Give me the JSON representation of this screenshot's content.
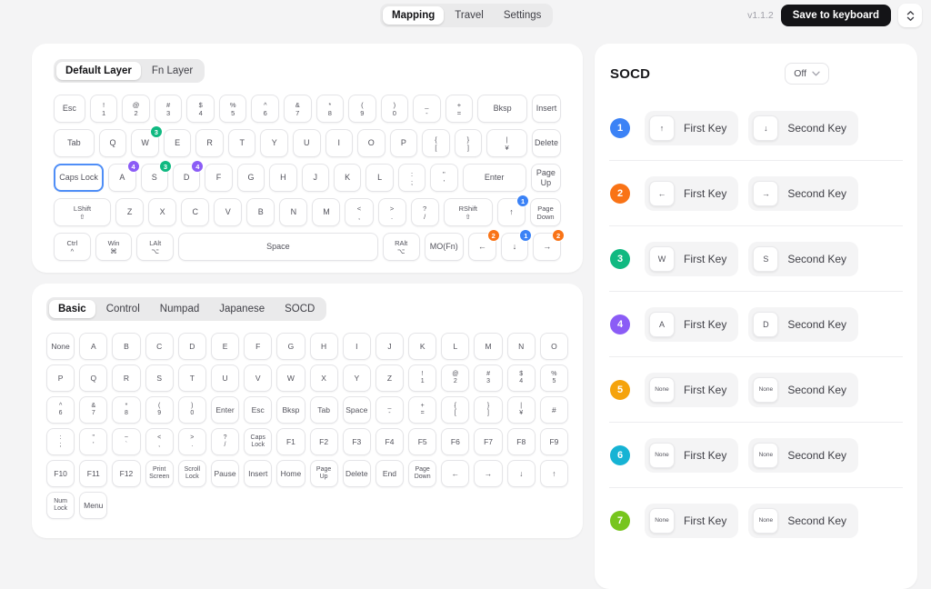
{
  "app": {
    "tabs": [
      "Mapping",
      "Travel",
      "Settings"
    ],
    "active_tab": "Mapping",
    "version": "v1.1.2",
    "save_label": "Save to keyboard",
    "updown_icon": "chevrons-up-down"
  },
  "layers": {
    "tabs": [
      "Default Layer",
      "Fn Layer"
    ],
    "active": "Default Layer"
  },
  "colors": {
    "blue": "#3b82f6",
    "orange": "#f97316",
    "green": "#10b981",
    "purple": "#8b5cf6",
    "amber": "#f5a30c",
    "cyan": "#16b3d4",
    "lime": "#77c51e"
  },
  "keyboard": {
    "rows": [
      [
        {
          "l": [
            "Esc"
          ],
          "w": 1.15
        },
        {
          "l": [
            "!",
            "1"
          ]
        },
        {
          "l": [
            "@",
            "2"
          ]
        },
        {
          "l": [
            "#",
            "3"
          ]
        },
        {
          "l": [
            "$",
            "4"
          ]
        },
        {
          "l": [
            "%",
            "5"
          ]
        },
        {
          "l": [
            "^",
            "6"
          ]
        },
        {
          "l": [
            "&",
            "7"
          ]
        },
        {
          "l": [
            "*",
            "8"
          ]
        },
        {
          "l": [
            "(",
            "9"
          ]
        },
        {
          "l": [
            ")",
            "0"
          ]
        },
        {
          "l": [
            "_",
            "-"
          ]
        },
        {
          "l": [
            "+",
            "="
          ]
        },
        {
          "l": [
            "Bksp"
          ],
          "w": 1.85
        },
        {
          "l": [
            "Insert"
          ],
          "w": 1.05
        }
      ],
      [
        {
          "l": [
            "Tab"
          ],
          "w": 1.5
        },
        {
          "l": [
            "Q"
          ]
        },
        {
          "l": [
            "W"
          ],
          "b": {
            "n": "3",
            "c": "green"
          }
        },
        {
          "l": [
            "E"
          ]
        },
        {
          "l": [
            "R"
          ]
        },
        {
          "l": [
            "T"
          ]
        },
        {
          "l": [
            "Y"
          ]
        },
        {
          "l": [
            "U"
          ]
        },
        {
          "l": [
            "I"
          ]
        },
        {
          "l": [
            "O"
          ]
        },
        {
          "l": [
            "P"
          ]
        },
        {
          "l": [
            "{",
            "["
          ]
        },
        {
          "l": [
            "}",
            "]"
          ]
        },
        {
          "l": [
            "|",
            "¥"
          ],
          "w": 1.5
        },
        {
          "l": [
            "Delete"
          ],
          "w": 1.05
        }
      ],
      [
        {
          "l": [
            "Caps Lock"
          ],
          "w": 1.8,
          "sel": true
        },
        {
          "l": [
            "A"
          ],
          "b": {
            "n": "4",
            "c": "purple"
          }
        },
        {
          "l": [
            "S"
          ],
          "b": {
            "n": "3",
            "c": "green"
          }
        },
        {
          "l": [
            "D"
          ],
          "b": {
            "n": "4",
            "c": "purple"
          }
        },
        {
          "l": [
            "F"
          ]
        },
        {
          "l": [
            "G"
          ]
        },
        {
          "l": [
            "H"
          ]
        },
        {
          "l": [
            "J"
          ]
        },
        {
          "l": [
            "K"
          ]
        },
        {
          "l": [
            "L"
          ]
        },
        {
          "l": [
            ":",
            ";"
          ]
        },
        {
          "l": [
            "\"",
            "'"
          ]
        },
        {
          "l": [
            "Enter"
          ],
          "w": 2.4
        },
        {
          "l": [
            "Page Up"
          ],
          "w": 1.1
        }
      ],
      [
        {
          "l": [
            "LShift",
            "⇧"
          ],
          "w": 2.1
        },
        {
          "l": [
            "Z"
          ]
        },
        {
          "l": [
            "X"
          ]
        },
        {
          "l": [
            "C"
          ]
        },
        {
          "l": [
            "V"
          ]
        },
        {
          "l": [
            "B"
          ]
        },
        {
          "l": [
            "N"
          ]
        },
        {
          "l": [
            "M"
          ]
        },
        {
          "l": [
            "<",
            ","
          ]
        },
        {
          "l": [
            ">",
            "."
          ]
        },
        {
          "l": [
            "?",
            "/"
          ]
        },
        {
          "l": [
            "RShift",
            "⇧"
          ],
          "w": 1.8
        },
        {
          "l": [
            "↑"
          ],
          "b": {
            "n": "1",
            "c": "blue"
          }
        },
        {
          "l": [
            "Page",
            "Down"
          ],
          "w": 1.1
        }
      ],
      [
        {
          "l": [
            "Ctrl",
            "^"
          ],
          "w": 1.35
        },
        {
          "l": [
            "Win",
            "⌘"
          ],
          "w": 1.35
        },
        {
          "l": [
            "LAlt",
            "⌥"
          ],
          "w": 1.35
        },
        {
          "l": [
            "Space"
          ],
          "w": 7.6
        },
        {
          "l": [
            "RAlt",
            "⌥"
          ],
          "w": 1.35
        },
        {
          "l": [
            "MO(Fn)"
          ],
          "w": 1.45
        },
        {
          "l": [
            "←"
          ],
          "b": {
            "n": "2",
            "c": "orange"
          }
        },
        {
          "l": [
            "↓"
          ],
          "b": {
            "n": "1",
            "c": "blue"
          }
        },
        {
          "l": [
            "→"
          ],
          "b": {
            "n": "2",
            "c": "orange"
          }
        }
      ]
    ]
  },
  "picker": {
    "tabs": [
      "Basic",
      "Control",
      "Numpad",
      "Japanese",
      "SOCD"
    ],
    "active": "Basic",
    "rows": [
      [
        [
          "None"
        ],
        [
          "A"
        ],
        [
          "B"
        ],
        [
          "C"
        ],
        [
          "D"
        ],
        [
          "E"
        ],
        [
          "F"
        ],
        [
          "G"
        ],
        [
          "H"
        ],
        [
          "I"
        ],
        [
          "J"
        ],
        [
          "K"
        ],
        [
          "L"
        ],
        [
          "M"
        ],
        [
          "N"
        ],
        [
          "O"
        ]
      ],
      [
        [
          "P"
        ],
        [
          "Q"
        ],
        [
          "R"
        ],
        [
          "S"
        ],
        [
          "T"
        ],
        [
          "U"
        ],
        [
          "V"
        ],
        [
          "W"
        ],
        [
          "X"
        ],
        [
          "Y"
        ],
        [
          "Z"
        ],
        [
          "!",
          "1"
        ],
        [
          "@",
          "2"
        ],
        [
          "#",
          "3"
        ],
        [
          "$",
          "4"
        ],
        [
          "%",
          "5"
        ]
      ],
      [
        [
          "^",
          "6"
        ],
        [
          "&",
          "7"
        ],
        [
          "*",
          "8"
        ],
        [
          "(",
          "9"
        ],
        [
          ")",
          "0"
        ],
        [
          "Enter"
        ],
        [
          "Esc"
        ],
        [
          "Bksp"
        ],
        [
          "Tab"
        ],
        [
          "Space"
        ],
        [
          "_",
          "-"
        ],
        [
          "+",
          "="
        ],
        [
          "{",
          "["
        ],
        [
          "}",
          "]"
        ],
        [
          "|",
          "¥"
        ],
        [
          "#"
        ]
      ],
      [
        [
          ":",
          ";"
        ],
        [
          "\"",
          "'"
        ],
        [
          "~",
          "`"
        ],
        [
          "<",
          ","
        ],
        [
          ">",
          "."
        ],
        [
          "?",
          "/"
        ],
        [
          "Caps",
          "Lock"
        ],
        [
          "F1"
        ],
        [
          "F2"
        ],
        [
          "F3"
        ],
        [
          "F4"
        ],
        [
          "F5"
        ],
        [
          "F6"
        ],
        [
          "F7"
        ],
        [
          "F8"
        ],
        [
          "F9"
        ]
      ],
      [
        [
          "F10"
        ],
        [
          "F11"
        ],
        [
          "F12"
        ],
        [
          "Print",
          "Screen"
        ],
        [
          "Scroll",
          "Lock"
        ],
        [
          "Pause"
        ],
        [
          "Insert"
        ],
        [
          "Home"
        ],
        [
          "Page",
          "Up"
        ],
        [
          "Delete"
        ],
        [
          "End"
        ],
        [
          "Page",
          "Down"
        ],
        [
          "←"
        ],
        [
          "→"
        ],
        [
          "↓"
        ],
        [
          "↑"
        ]
      ],
      [
        [
          "Num",
          "Lock"
        ],
        [
          "Menu"
        ]
      ]
    ]
  },
  "socd": {
    "title": "SOCD",
    "mode": "Off",
    "first_label": "First Key",
    "second_label": "Second Key",
    "entries": [
      {
        "n": "1",
        "color": "blue",
        "first": "↑",
        "second": "↓"
      },
      {
        "n": "2",
        "color": "orange",
        "first": "←",
        "second": "→"
      },
      {
        "n": "3",
        "color": "green",
        "first": "W",
        "second": "S"
      },
      {
        "n": "4",
        "color": "purple",
        "first": "A",
        "second": "D"
      },
      {
        "n": "5",
        "color": "amber",
        "first": "None",
        "second": "None"
      },
      {
        "n": "6",
        "color": "cyan",
        "first": "None",
        "second": "None"
      },
      {
        "n": "7",
        "color": "lime",
        "first": "None",
        "second": "None"
      }
    ]
  }
}
